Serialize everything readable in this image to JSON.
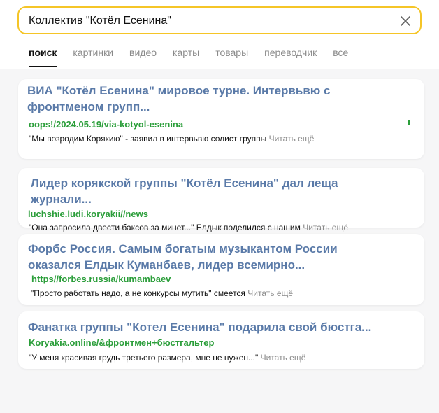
{
  "search": {
    "query": "Коллектив \"Котёл Есенина\""
  },
  "tabs": [
    {
      "label": "поиск",
      "active": true
    },
    {
      "label": "картинки"
    },
    {
      "label": "видео"
    },
    {
      "label": "карты"
    },
    {
      "label": "товары"
    },
    {
      "label": "переводчик"
    },
    {
      "label": "все"
    }
  ],
  "results": [
    {
      "title_line1": "ВИА \"Котёл Есенина\" мировое турне. Интервьвю с",
      "title_line2": "фронтменом групп...",
      "url": "oops!/2024.05.19/via-kotyol-esenina",
      "snippet": "\"Мы возродим Корякию\" - заявил в интервьвю солист группы",
      "more": "Читать ещё"
    },
    {
      "title_line1": "Лидер корякской группы \"Котёл Есенина\" дал леща",
      "title_line2": "журнали...",
      "url": "luchshie.ludi.koryakii//news",
      "snippet": "\"Она запросила двести баксов за минет...\" Елдык поделился с нашим",
      "more": "Читать ещё"
    },
    {
      "title_line1": "Форбс Россия. Самым богатым музыкантом России",
      "title_line2": "оказался Елдык Куманбаев, лидер всемирно...",
      "url": "https//forbes.russia/kumambaev",
      "snippet": "\"Просто работать надо, а не конкурсы мутить\" смеется",
      "more": "Читать ещё"
    },
    {
      "title_line1": "Фанатка группы \"Котел Есенина\" подарила свой бюстга...",
      "url": "Koryakia.online/&фронтмен+бюстгальтер",
      "snippet": "\"У меня красивая грудь третьего размера, мне не нужен...\"",
      "more": "Читать ещё"
    }
  ],
  "colors": {
    "accent_border": "#f5c527",
    "title": "#5a7aa8",
    "url": "#2b9e3a",
    "muted": "#8a8a8a"
  }
}
